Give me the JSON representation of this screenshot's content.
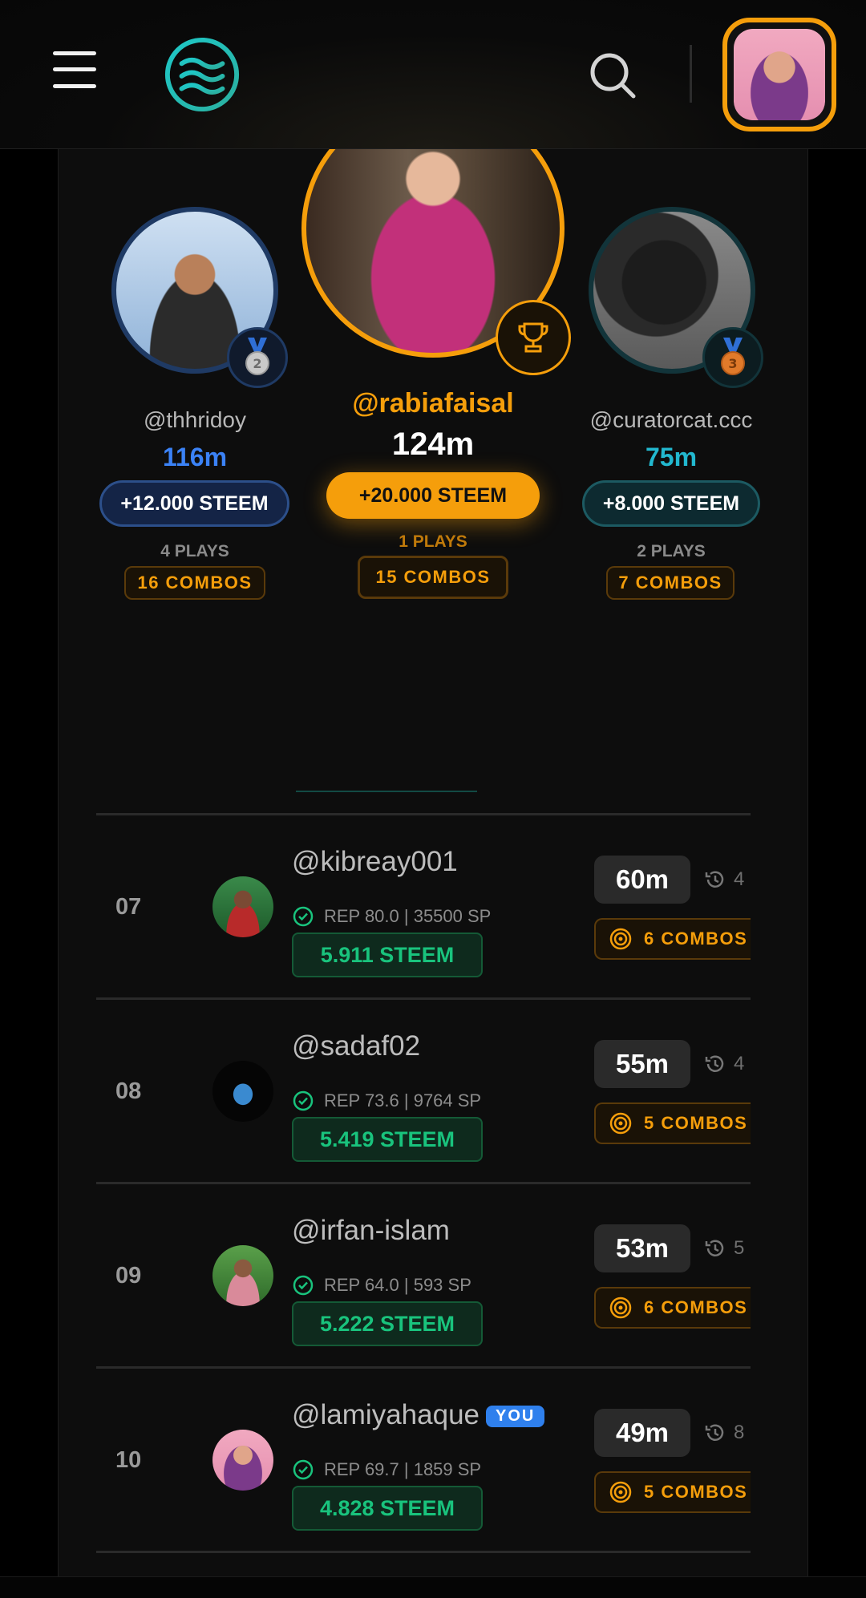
{
  "header": {
    "menu_icon": "hamburger-menu-icon",
    "logo_icon": "wave-logo-icon",
    "search_icon": "search-icon",
    "profile_border_color": "#f59e0b"
  },
  "podium": [
    {
      "rank_label": "2",
      "username": "@thhridoy",
      "score": "116m",
      "score_color": "#3b82f6",
      "reward": "+12.000 STEEM",
      "plays": "4 PLAYS",
      "combos": "16 COMBOS",
      "badge_icon": "silver-medal-icon"
    },
    {
      "rank_label": "1",
      "username": "@rabiafaisal",
      "score": "124m",
      "score_color": "#ffffff",
      "reward": "+20.000 STEEM",
      "plays": "1 PLAYS",
      "combos": "15 COMBOS",
      "badge_icon": "trophy-icon"
    },
    {
      "rank_label": "3",
      "username": "@curatorcat.ccc",
      "score": "75m",
      "score_color": "#22b8cf",
      "reward": "+8.000 STEEM",
      "plays": "2 PLAYS",
      "combos": "7 COMBOS",
      "badge_icon": "bronze-medal-icon"
    }
  ],
  "rows": [
    {
      "rank": "07",
      "username": "@kibreay001",
      "you": "",
      "rep": "REP 80.0 | 35500 SP",
      "steem": "5.911 STEEM",
      "score": "60m",
      "time_partial": "4",
      "combos": "6 COMBOS"
    },
    {
      "rank": "08",
      "username": "@sadaf02",
      "you": "",
      "rep": "REP 73.6 | 9764 SP",
      "steem": "5.419 STEEM",
      "score": "55m",
      "time_partial": "4",
      "combos": "5 COMBOS"
    },
    {
      "rank": "09",
      "username": "@irfan-islam",
      "you": "",
      "rep": "REP 64.0 | 593 SP",
      "steem": "5.222 STEEM",
      "score": "53m",
      "time_partial": "5",
      "combos": "6 COMBOS"
    },
    {
      "rank": "10",
      "username": "@lamiyahaque",
      "you": "YOU",
      "rep": "REP 69.7 | 1859 SP",
      "steem": "4.828 STEEM",
      "score": "49m",
      "time_partial": "8",
      "combos": "5 COMBOS"
    }
  ],
  "colors": {
    "accent_gold": "#f59e0b",
    "steem_green": "#19c37d",
    "you_badge": "#2f80ed"
  }
}
